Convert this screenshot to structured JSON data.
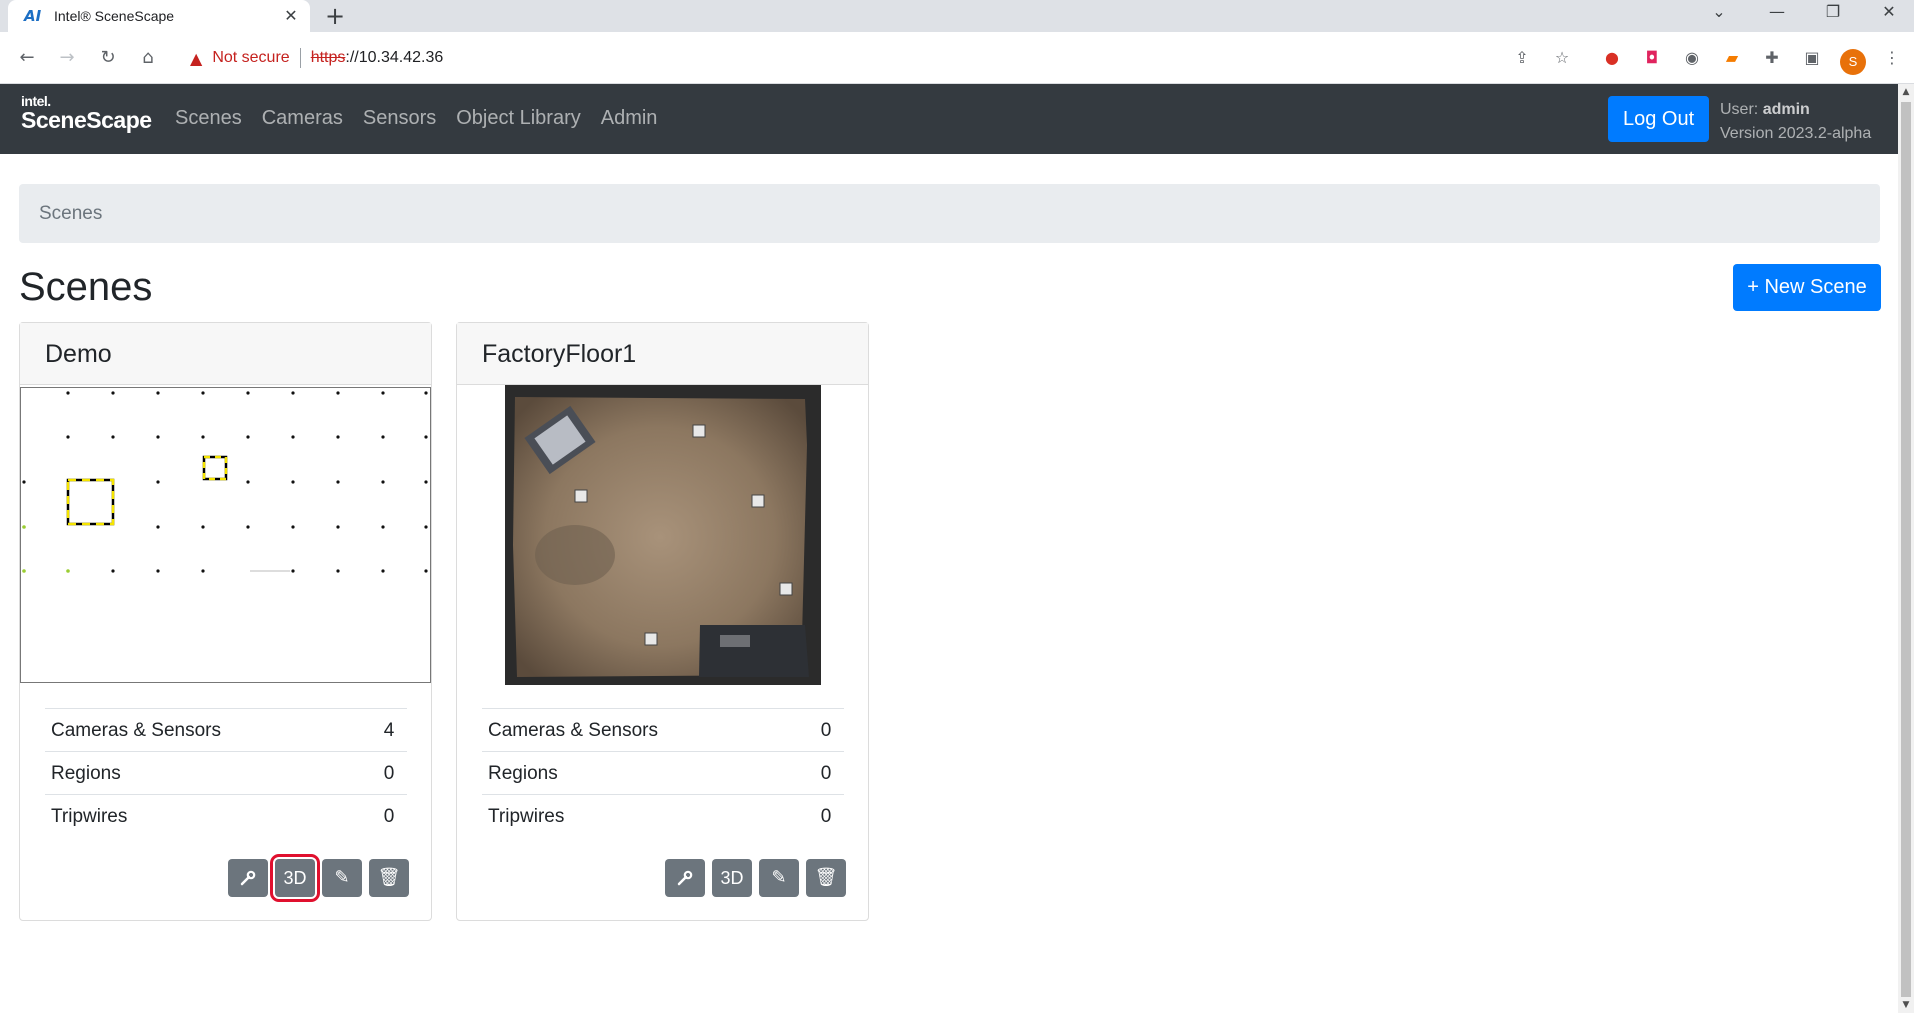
{
  "browser": {
    "tab_title": "Intel® SceneScape",
    "tab_favicon": "AI",
    "not_secure": "Not secure",
    "url_protocol": "https",
    "url_rest": "://10.34.42.36",
    "profile_initial": "S"
  },
  "app": {
    "brand_top": "intel.",
    "brand_name": "SceneScape",
    "nav": [
      "Scenes",
      "Cameras",
      "Sensors",
      "Object Library",
      "Admin"
    ],
    "logout_label": "Log Out",
    "user_label": "User:",
    "user_name": "admin",
    "version": "Version 2023.2-alpha"
  },
  "breadcrumb": "Scenes",
  "page_title": "Scenes",
  "new_scene_label": "+ New Scene",
  "scenes": [
    {
      "name": "Demo",
      "stats": [
        {
          "label": "Cameras & Sensors",
          "value": "4"
        },
        {
          "label": "Regions",
          "value": "0"
        },
        {
          "label": "Tripwires",
          "value": "0"
        }
      ],
      "actions": [
        "wrench-icon",
        "3D",
        "pencil-icon",
        "trash-icon"
      ]
    },
    {
      "name": "FactoryFloor1",
      "stats": [
        {
          "label": "Cameras & Sensors",
          "value": "0"
        },
        {
          "label": "Regions",
          "value": "0"
        },
        {
          "label": "Tripwires",
          "value": "0"
        }
      ],
      "actions": [
        "wrench-icon",
        "3D",
        "pencil-icon",
        "trash-icon"
      ]
    }
  ],
  "colors": {
    "navbar": "#343a40",
    "primary": "#007bff",
    "secondary_btn": "#6c757d",
    "highlight": "#e0102e"
  }
}
